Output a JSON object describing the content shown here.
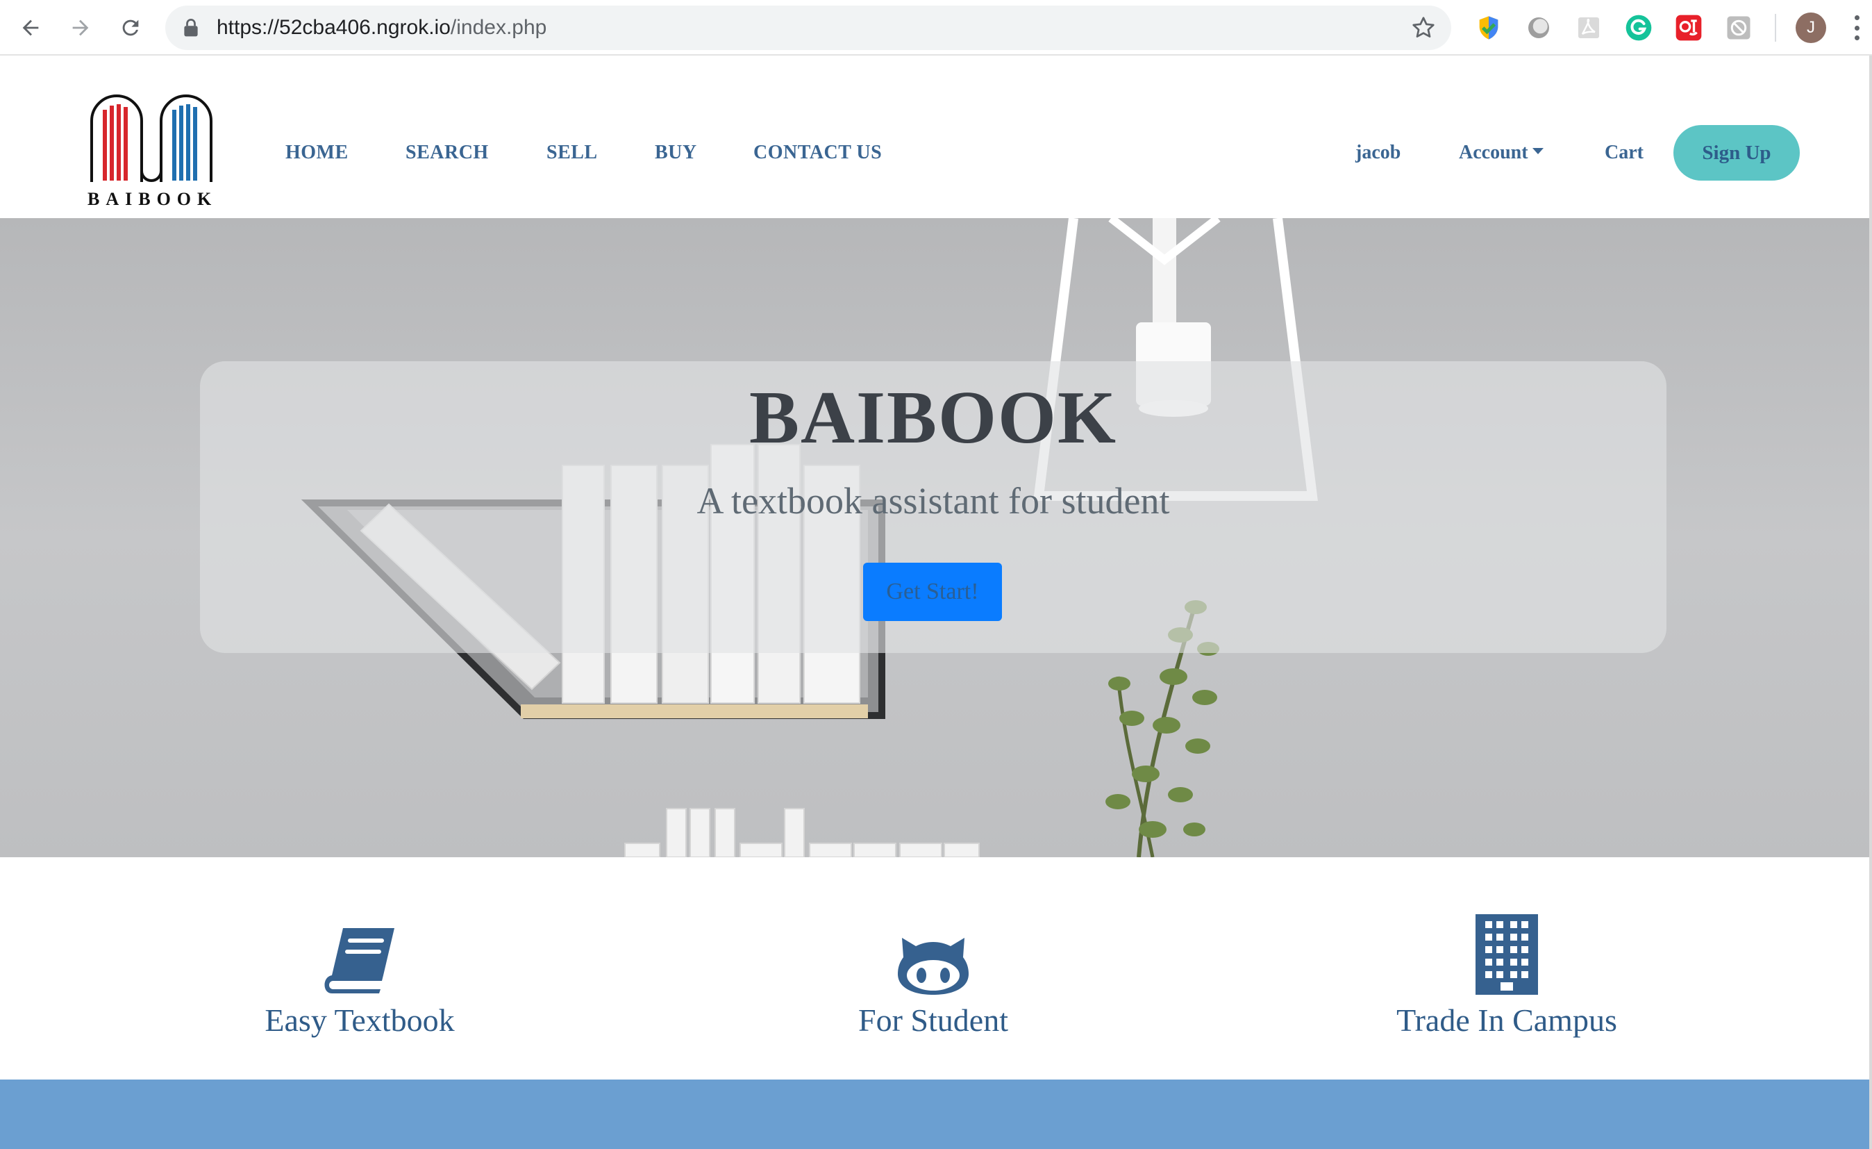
{
  "browser": {
    "url_host": "https://52cba406.ngrok.io",
    "url_path": "/index.php",
    "profile_initial": "J",
    "icons": [
      "back-arrow-icon",
      "forward-arrow-icon",
      "reload-icon",
      "lock-icon",
      "bookmark-star-icon",
      "extension-icons",
      "profile-avatar",
      "menu-kebab-icon"
    ]
  },
  "logo": {
    "text": "BAIBOOK"
  },
  "nav": {
    "items": [
      {
        "label": "HOME"
      },
      {
        "label": "SEARCH"
      },
      {
        "label": "SELL"
      },
      {
        "label": "BUY"
      },
      {
        "label": "CONTACT US"
      }
    ],
    "user": "jacob",
    "account": "Account",
    "cart": "Cart",
    "signup": "Sign Up"
  },
  "hero": {
    "title": "BAIBOOK",
    "subtitle": "A textbook assistant for student",
    "button": "Get Start!"
  },
  "features": [
    {
      "icon": "book-icon",
      "label": "Easy Textbook"
    },
    {
      "icon": "github-icon",
      "label": "For Student"
    },
    {
      "icon": "building-icon",
      "label": "Trade In Campus"
    }
  ],
  "colors": {
    "nav_text": "#3a6592",
    "signup_bg": "#5cc5c5",
    "hero_button": "#0a7cff",
    "feature_icon": "#36618f",
    "footer_band": "#6b9fd1"
  }
}
